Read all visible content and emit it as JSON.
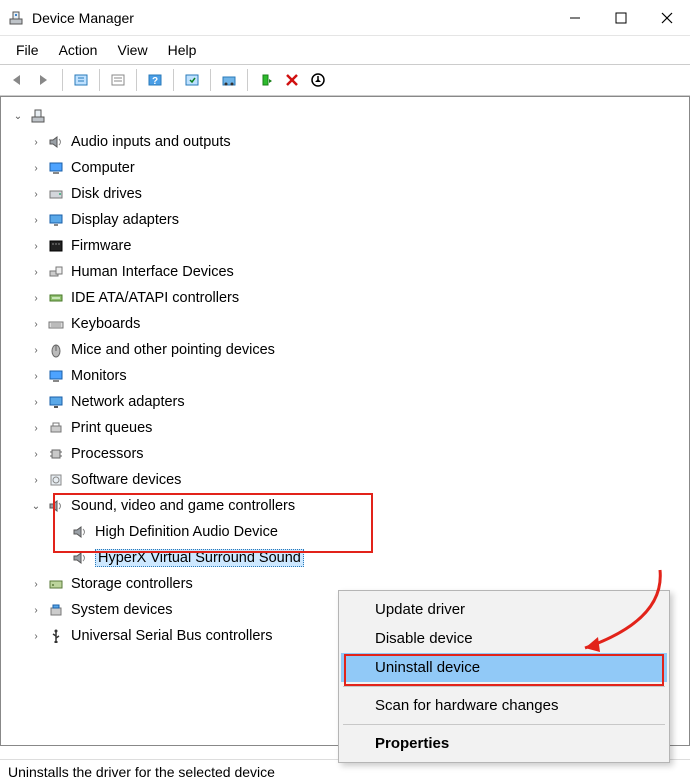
{
  "window": {
    "title": "Device Manager"
  },
  "menus": {
    "file": "File",
    "action": "Action",
    "view": "View",
    "help": "Help"
  },
  "tree": {
    "root": {
      "expanded": true
    },
    "categories": [
      {
        "label": "Audio inputs and outputs",
        "icon": "speaker"
      },
      {
        "label": "Computer",
        "icon": "monitor-blue"
      },
      {
        "label": "Disk drives",
        "icon": "disk"
      },
      {
        "label": "Display adapters",
        "icon": "display-adapter"
      },
      {
        "label": "Firmware",
        "icon": "firmware"
      },
      {
        "label": "Human Interface Devices",
        "icon": "hid"
      },
      {
        "label": "IDE ATA/ATAPI controllers",
        "icon": "ide"
      },
      {
        "label": "Keyboards",
        "icon": "keyboard"
      },
      {
        "label": "Mice and other pointing devices",
        "icon": "mouse"
      },
      {
        "label": "Monitors",
        "icon": "monitor-blue"
      },
      {
        "label": "Network adapters",
        "icon": "network"
      },
      {
        "label": "Print queues",
        "icon": "printer"
      },
      {
        "label": "Processors",
        "icon": "cpu"
      },
      {
        "label": "Software devices",
        "icon": "software"
      },
      {
        "label": "Sound, video and game controllers",
        "icon": "speaker",
        "expanded": true,
        "children": [
          {
            "label": "High Definition Audio Device",
            "icon": "speaker"
          },
          {
            "label": "HyperX Virtual Surround Sound",
            "icon": "speaker",
            "selected": true
          }
        ]
      },
      {
        "label": "Storage controllers",
        "icon": "storage"
      },
      {
        "label": "System devices",
        "icon": "system"
      },
      {
        "label": "Universal Serial Bus controllers",
        "icon": "usb"
      }
    ]
  },
  "context_menu": {
    "items": [
      {
        "label": "Update driver"
      },
      {
        "label": "Disable device"
      },
      {
        "label": "Uninstall device",
        "selected": true
      },
      {
        "sep": true
      },
      {
        "label": "Scan for hardware changes"
      },
      {
        "sep": true
      },
      {
        "label": "Properties",
        "bold": true
      }
    ]
  },
  "status": "Uninstalls the driver for the selected device"
}
